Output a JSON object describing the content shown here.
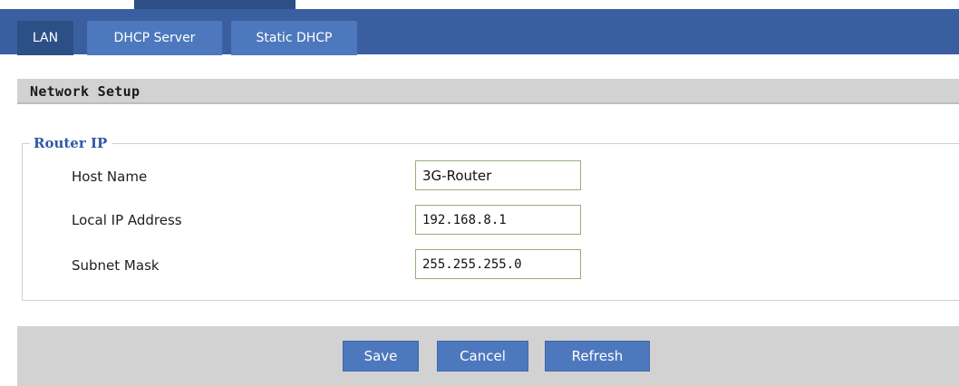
{
  "tabs": [
    {
      "label": "LAN",
      "active": true
    },
    {
      "label": "DHCP Server",
      "active": false
    },
    {
      "label": "Static DHCP",
      "active": false
    }
  ],
  "section": {
    "title": "Network Setup"
  },
  "fieldset": {
    "legend": "Router IP",
    "rows": [
      {
        "label": "Host Name",
        "value": "3G-Router"
      },
      {
        "label": "Local IP Address",
        "value": "192.168.8.1"
      },
      {
        "label": "Subnet Mask",
        "value": "255.255.255.0"
      }
    ]
  },
  "buttons": {
    "save": "Save",
    "cancel": "Cancel",
    "refresh": "Refresh"
  },
  "colors": {
    "tabbar": "#3a5fa0",
    "tab": "#4d78bd",
    "tab_active": "#2c4f86",
    "legend": "#2e5aa8",
    "input_border": "#92b17a",
    "panel_gray": "#d2d2d2"
  }
}
